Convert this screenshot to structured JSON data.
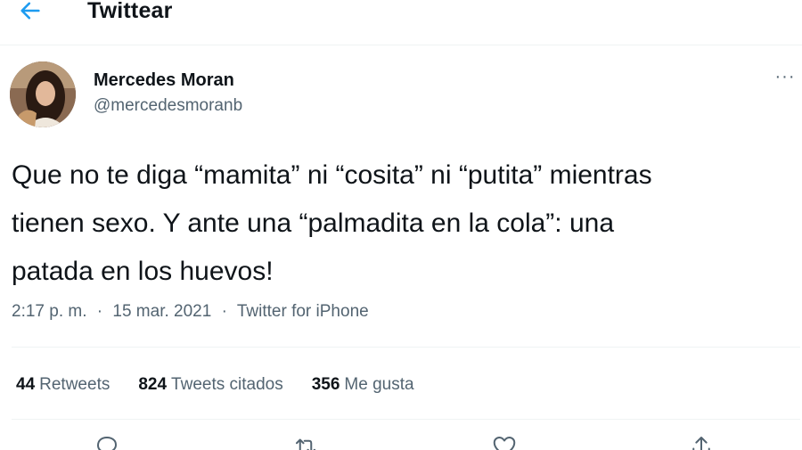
{
  "header": {
    "title": "Twittear",
    "back_icon": "arrow-left-icon",
    "accent_color": "#1d9bf0"
  },
  "author": {
    "name": "Mercedes Moran",
    "handle": "@mercedesmoranb"
  },
  "more_label": "···",
  "tweet": {
    "text": "Que no te diga “mamita” ni “cosita” ni “putita” mientras\ntienen sexo. Y ante una “palmadita en la cola”: una\npatada en los huevos!"
  },
  "meta": {
    "time": "2:17 p. m.",
    "separator": "·",
    "date": "15 mar. 2021",
    "source": "Twitter for iPhone"
  },
  "stats": {
    "retweets": {
      "count": "44",
      "label": "Retweets"
    },
    "quotes": {
      "count": "824",
      "label": "Tweets citados"
    },
    "likes": {
      "count": "356",
      "label": "Me gusta"
    }
  },
  "actions": [
    {
      "icon": "reply-icon"
    },
    {
      "icon": "retweet-icon"
    },
    {
      "icon": "like-icon"
    },
    {
      "icon": "share-icon"
    }
  ]
}
